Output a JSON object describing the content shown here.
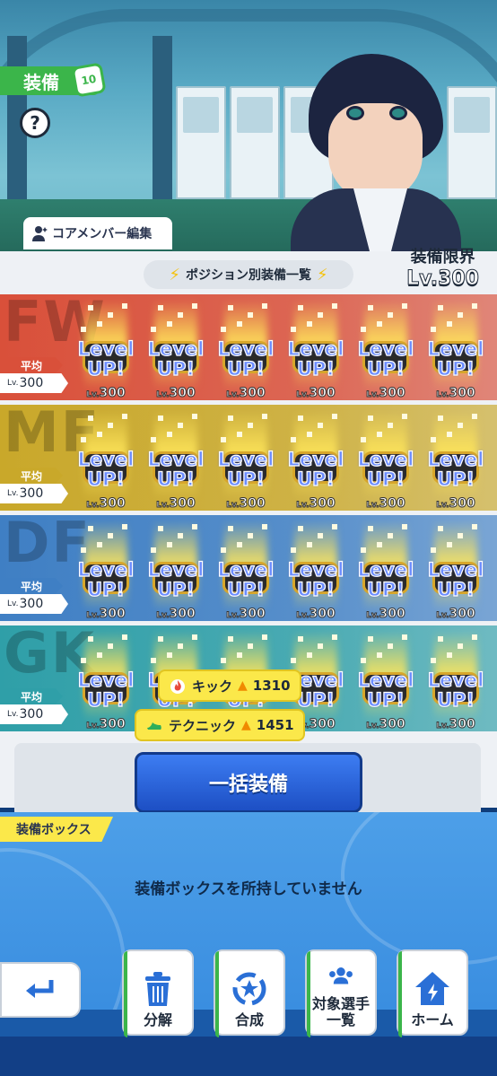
{
  "header": {
    "title": "装備",
    "title_badge": "10",
    "help_label": "?",
    "core_member_edit": "コアメンバー編集"
  },
  "list": {
    "title": "ポジション別装備一覧",
    "limit_label": "装備限界",
    "limit_value": "Lv.300",
    "average_label": "平均",
    "lv_prefix": "Lv.",
    "level_up_line1": "Level",
    "level_up_line2": "UP!",
    "rows": [
      {
        "position": "FW",
        "average": "300",
        "color": "#d9503a",
        "slot_levels": [
          "300",
          "300",
          "300",
          "300",
          "300",
          "300"
        ]
      },
      {
        "position": "MF",
        "average": "300",
        "color": "#c9a82a",
        "slot_levels": [
          "300",
          "300",
          "300",
          "300",
          "300",
          "300"
        ]
      },
      {
        "position": "DF",
        "average": "300",
        "color": "#3f7fc4",
        "slot_levels": [
          "300",
          "300",
          "300",
          "300",
          "300",
          "300"
        ]
      },
      {
        "position": "GK",
        "average": "300",
        "color": "#2f9fa8",
        "slot_levels": [
          "300",
          "300",
          "300",
          "300",
          "300",
          "300"
        ]
      }
    ]
  },
  "tooltips": [
    {
      "label": "キック",
      "value": "1310",
      "icon": "fire-icon"
    },
    {
      "label": "テクニック",
      "value": "1451",
      "icon": "shoe-icon"
    }
  ],
  "bulk_equip_label": "一括装備",
  "equipment_box": {
    "label": "装備ボックス",
    "empty_message": "装備ボックスを所持していません"
  },
  "nav": {
    "back_icon": "return-arrow-icon",
    "items": [
      {
        "label": "分解",
        "icon": "trash-icon"
      },
      {
        "label": "合成",
        "icon": "cycle-star-icon"
      },
      {
        "label": "対象選手\n一覧",
        "label_line1": "対象選手",
        "label_line2": "一覧",
        "icon": "players-icon"
      },
      {
        "label": "ホーム",
        "icon": "home-icon"
      }
    ]
  }
}
